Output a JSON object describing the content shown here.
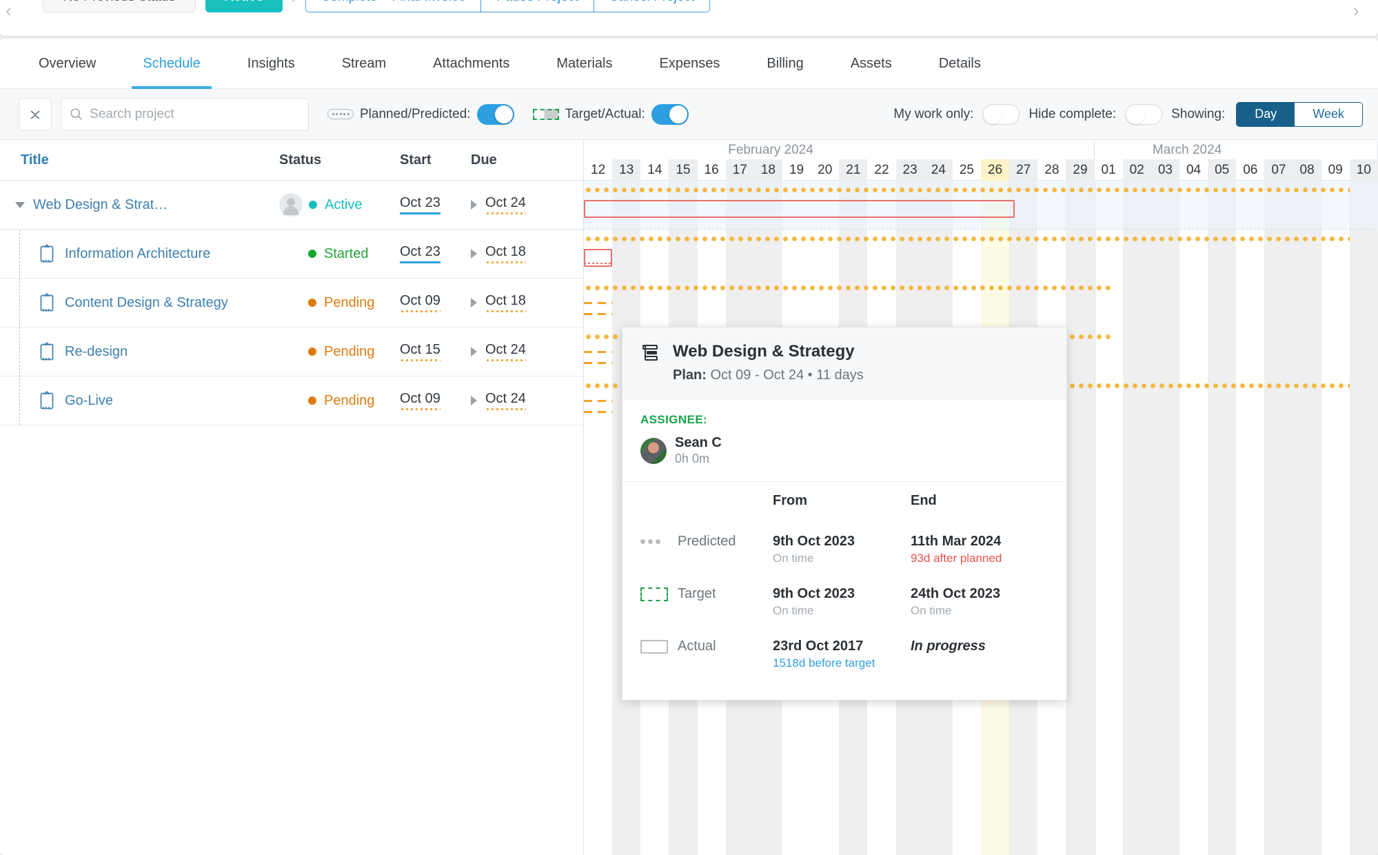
{
  "status_strip": {
    "previous_label": "No Previous Status",
    "active_label": "Active",
    "separator": "›",
    "actions": [
      "Complete + Final Invoice",
      "Pause Project",
      "Cancel Project"
    ],
    "active_color": "#18c1bf"
  },
  "tabs": [
    {
      "label": "Overview",
      "active": false
    },
    {
      "label": "Schedule",
      "active": true
    },
    {
      "label": "Insights",
      "active": false
    },
    {
      "label": "Stream",
      "active": false
    },
    {
      "label": "Attachments",
      "active": false
    },
    {
      "label": "Materials",
      "active": false
    },
    {
      "label": "Expenses",
      "active": false
    },
    {
      "label": "Billing",
      "active": false
    },
    {
      "label": "Assets",
      "active": false
    },
    {
      "label": "Details",
      "active": false
    }
  ],
  "toolbar": {
    "search_placeholder": "Search project",
    "search_value": "",
    "planned_predicted_label": "Planned/Predicted:",
    "planned_predicted_on": true,
    "target_actual_label": "Target/Actual:",
    "target_actual_on": true,
    "my_work_only_label": "My work only:",
    "my_work_only_on": false,
    "hide_complete_label": "Hide complete:",
    "hide_complete_on": false,
    "showing_label": "Showing:",
    "showing_options": [
      "Day",
      "Week"
    ],
    "showing_selected": "Day"
  },
  "table": {
    "headers": {
      "title": "Title",
      "status": "Status",
      "start": "Start",
      "due": "Due"
    },
    "rows": [
      {
        "title": "Web Design & Strat…",
        "is_parent": true,
        "has_avatar": true,
        "status": "Active",
        "status_kind": "active",
        "start": "Oct 23",
        "start_underline": "blue",
        "due": "Oct 24",
        "due_underline": "orange"
      },
      {
        "title": "Information Architecture",
        "is_parent": false,
        "has_avatar": false,
        "status": "Started",
        "status_kind": "started",
        "start": "Oct 23",
        "start_underline": "blue",
        "due": "Oct 18",
        "due_underline": "orange"
      },
      {
        "title": "Content Design & Strategy",
        "is_parent": false,
        "has_avatar": false,
        "status": "Pending",
        "status_kind": "pending",
        "start": "Oct 09",
        "start_underline": "orange",
        "due": "Oct 18",
        "due_underline": "orange"
      },
      {
        "title": "Re-design",
        "is_parent": false,
        "has_avatar": false,
        "status": "Pending",
        "status_kind": "pending",
        "start": "Oct 15",
        "start_underline": "orange",
        "due": "Oct 24",
        "due_underline": "orange"
      },
      {
        "title": "Go-Live",
        "is_parent": false,
        "has_avatar": false,
        "status": "Pending",
        "status_kind": "pending",
        "start": "Oct 09",
        "start_underline": "orange",
        "due": "Oct 24",
        "due_underline": "orange"
      }
    ]
  },
  "gantt": {
    "months": [
      {
        "label": "February 2024",
        "days": 18
      },
      {
        "label": "March 2024",
        "days": 10
      }
    ],
    "days": [
      "12",
      "13",
      "14",
      "15",
      "16",
      "17",
      "18",
      "19",
      "20",
      "21",
      "22",
      "23",
      "24",
      "25",
      "26",
      "27",
      "28",
      "29",
      "01",
      "02",
      "03",
      "04",
      "05",
      "06",
      "07",
      "08",
      "09",
      "10"
    ],
    "shaded_days": [
      "13",
      "15",
      "17",
      "18",
      "21",
      "23",
      "24",
      "27",
      "29",
      "02",
      "03",
      "05",
      "07",
      "08",
      "10"
    ],
    "today": "26",
    "today_color": "#fdf3c6",
    "bars": [
      {
        "row": 0,
        "predicted": {
          "start": 0,
          "end": 27
        },
        "actual": {
          "start": 0,
          "end": 15.2
        }
      },
      {
        "row": 1,
        "predicted": {
          "start": 0,
          "end": 27
        },
        "actual": {
          "start": 0,
          "end": 1.0
        },
        "target": {
          "start": 0,
          "end": 1.0
        }
      },
      {
        "row": 2,
        "predicted": {
          "start": 0,
          "end": 18.6
        },
        "planned": {
          "start": 0,
          "end": 1.0
        }
      },
      {
        "row": 3,
        "predicted": {
          "start": 0,
          "end": 18.6
        },
        "planned": {
          "start": 0,
          "end": 1.0
        }
      },
      {
        "row": 4,
        "predicted": {
          "start": 0,
          "end": 27
        },
        "planned": {
          "start": 0,
          "end": 1.0
        }
      }
    ]
  },
  "tooltip": {
    "icon": "gantt-task-icon",
    "title": "Web Design & Strategy",
    "plan_label": "Plan:",
    "plan_value": "Oct 09 - Oct 24 • 11 days",
    "assignee_label": "ASSIGNEE:",
    "assignee_name": "Sean C",
    "assignee_time": "0h 0m",
    "col_from": "From",
    "col_end": "End",
    "rows": [
      {
        "key": "Predicted",
        "icon": "dots-icon",
        "from": "9th Oct 2023",
        "from_sub": "On time",
        "from_sub_kind": "grey",
        "end": "11th Mar 2024",
        "end_sub": "93d after planned",
        "end_sub_kind": "red",
        "end_italic": false
      },
      {
        "key": "Target",
        "icon": "dashed-box-icon",
        "from": "9th Oct 2023",
        "from_sub": "On time",
        "from_sub_kind": "grey",
        "end": "24th Oct 2023",
        "end_sub": "On time",
        "end_sub_kind": "grey",
        "end_italic": false
      },
      {
        "key": "Actual",
        "icon": "solid-box-icon",
        "from": "23rd Oct 2017",
        "from_sub": "1518d before target",
        "from_sub_kind": "blue",
        "end": "In progress",
        "end_sub": "",
        "end_sub_kind": "grey",
        "end_italic": true
      }
    ]
  }
}
